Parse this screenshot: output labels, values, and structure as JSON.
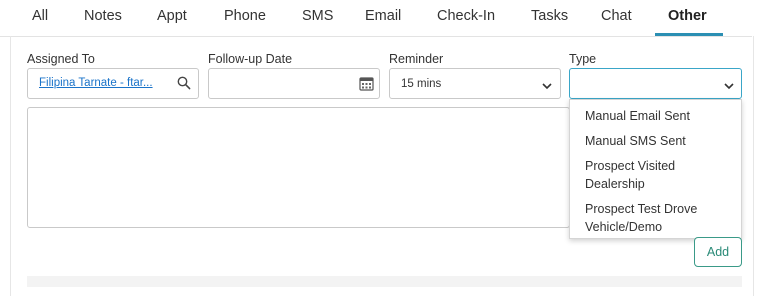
{
  "tabs": [
    {
      "label": "All"
    },
    {
      "label": "Notes"
    },
    {
      "label": "Appt"
    },
    {
      "label": "Phone"
    },
    {
      "label": "SMS"
    },
    {
      "label": "Email"
    },
    {
      "label": "Check-In"
    },
    {
      "label": "Tasks"
    },
    {
      "label": "Chat"
    },
    {
      "label": "Other",
      "active": true
    }
  ],
  "form": {
    "assigned_label": "Assigned To",
    "assigned_value": "Filipina Tarnate - ftar...",
    "followup_label": "Follow-up Date",
    "followup_value": "",
    "reminder_label": "Reminder",
    "reminder_value": "15 mins",
    "type_label": "Type",
    "type_value": ""
  },
  "type_options": [
    "Manual Email Sent",
    "Manual SMS Sent",
    "Prospect Visited Dealership",
    "Prospect Test Drove Vehicle/Demo"
  ],
  "add_label": "Add",
  "colors": {
    "active_tab_underline": "#2b8fb3",
    "link": "#1a73c9",
    "focus_border": "#3aa6c8",
    "add_button": "#2a8a77"
  },
  "icons": [
    "search-icon",
    "calendar-icon",
    "chevron-down-icon"
  ]
}
